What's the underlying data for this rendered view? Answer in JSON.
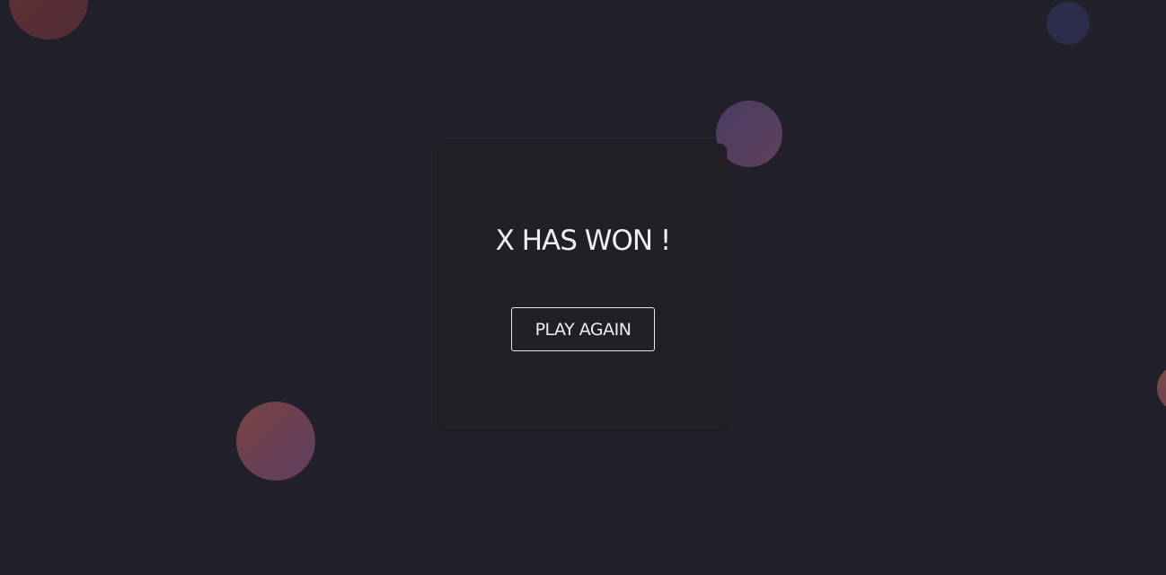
{
  "game": {
    "result_message": "X HAS WON !",
    "play_again_label": "PLAY AGAIN"
  },
  "colors": {
    "background": "#22202b",
    "modal_background": "#222024",
    "text": "#f0eef2"
  }
}
